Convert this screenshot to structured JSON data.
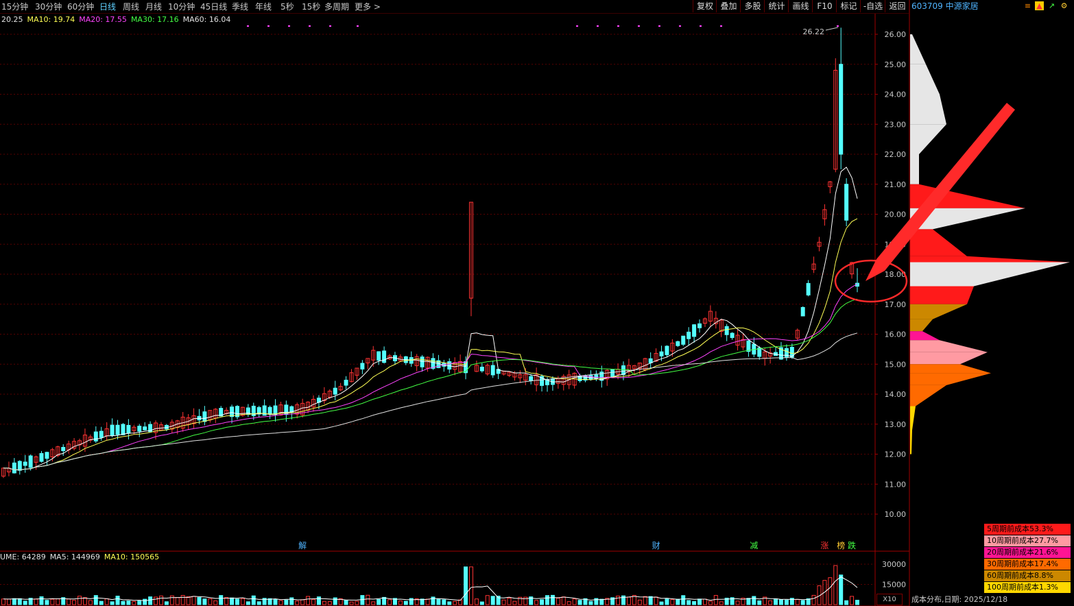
{
  "toolbar": {
    "periods": [
      "15分钟",
      "30分钟",
      "60分钟",
      "日线",
      "周线",
      "月线",
      "10分钟",
      "45日线",
      "季线",
      "年线",
      "5秒",
      "15秒",
      "多周期",
      "更多 >"
    ],
    "active_period": "日线",
    "buttons": [
      "复权",
      "叠加",
      "多股",
      "统计",
      "画线",
      "F10",
      "标记",
      "-自选",
      "返回"
    ]
  },
  "stock": {
    "code_name": "603709 中源家居"
  },
  "ma_legend": [
    {
      "text": "20.25",
      "color": "#e0e0e0"
    },
    {
      "text": "MA10: 19.74",
      "color": "#ffff55"
    },
    {
      "text": "MA20: 17.55",
      "color": "#ff44ff"
    },
    {
      "text": "MA30: 17.16",
      "color": "#44ff44"
    },
    {
      "text": "MA60: 16.04",
      "color": "#e0e0e0"
    }
  ],
  "volume_legend": [
    {
      "text": "UME: 64289",
      "color": "#e0e0e0"
    },
    {
      "text": "MA5: 144969",
      "color": "#e0e0e0"
    },
    {
      "text": "MA10: 150565",
      "color": "#ffff55"
    }
  ],
  "price_axis": [
    "26.00",
    "25.00",
    "24.00",
    "23.00",
    "22.00",
    "21.00",
    "20.00",
    "19.00",
    "18.00",
    "17.00",
    "16.00",
    "15.00",
    "14.00",
    "13.00",
    "12.00",
    "11.00",
    "10.00"
  ],
  "volume_axis": [
    "30000",
    "15000"
  ],
  "peak_label": "26.22",
  "event_markers": [
    {
      "text": "解",
      "color": "#4fb4ff",
      "day": 55
    },
    {
      "text": "财",
      "color": "#4fb4ff",
      "day": 120
    },
    {
      "text": "减",
      "color": "#44ff44",
      "day": 138
    },
    {
      "text": "涨",
      "color": "#ff3333",
      "day": 151
    },
    {
      "text": "榜",
      "color": "#ffcc33",
      "day": 154
    },
    {
      "text": "跌",
      "color": "#44ff44",
      "day": 156
    }
  ],
  "cost_legend": [
    {
      "text": "5周期前成本53.3%",
      "color": "#ff1a1a"
    },
    {
      "text": "10周期前成本27.7%",
      "color": "#ff9aa2"
    },
    {
      "text": "20周期前成本21.6%",
      "color": "#ff1493"
    },
    {
      "text": "30周期前成本17.4%",
      "color": "#ff6a00"
    },
    {
      "text": "60周期前成本8.8%",
      "color": "#cc8800"
    },
    {
      "text": "100周期前成本1.3%",
      "color": "#ffd700"
    }
  ],
  "cost_footer": "成本分布,日期: 2025/12/18",
  "zoom_label": "X10",
  "colors": {
    "up": "#ff3333",
    "down": "#54ffff",
    "grid": "#5a0000",
    "axis": "#a00000"
  }
}
